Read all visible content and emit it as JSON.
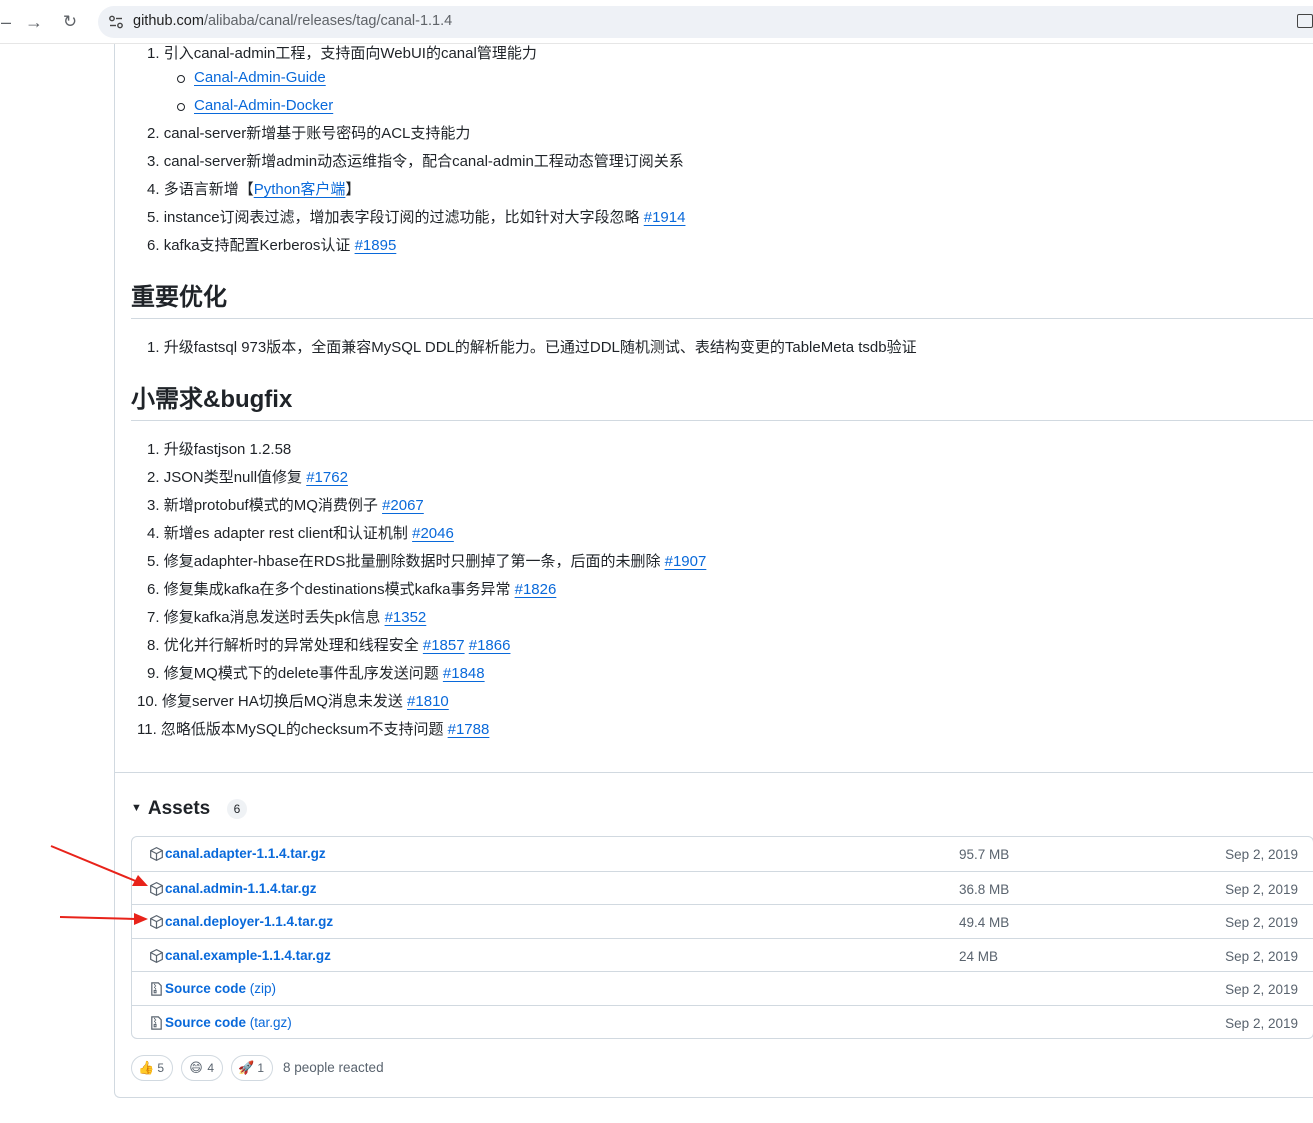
{
  "browser": {
    "url_host": "github.com",
    "url_path": "/alibaba/canal/releases/tag/canal-1.1.4"
  },
  "new_features": {
    "items": [
      {
        "num": "1.",
        "text": "引入canal-admin工程，支持面向WebUI的canal管理能力"
      },
      {
        "num": "2.",
        "text": "canal-server新增基于账号密码的ACL支持能力"
      },
      {
        "num": "3.",
        "text": "canal-server新增admin动态运维指令，配合canal-admin工程动态管理订阅关系"
      },
      {
        "num": "4.",
        "text_before": "多语言新增【",
        "link": "Python客户端",
        "text_after": "】"
      },
      {
        "num": "5.",
        "text": "instance订阅表过滤，增加表字段订阅的过滤功能，比如针对大字段忽略 ",
        "link": "#1914"
      },
      {
        "num": "6.",
        "text": "kafka支持配置Kerberos认证 ",
        "link": "#1895"
      }
    ],
    "sub_items": [
      "Canal-Admin-Guide",
      "Canal-Admin-Docker"
    ]
  },
  "optimization": {
    "heading": "重要优化",
    "items": [
      {
        "num": "1.",
        "text": "升级fastsql 973版本，全面兼容MySQL DDL的解析能力。已通过DDL随机测试、表结构变更的TableMeta tsdb验证"
      }
    ]
  },
  "bugfix": {
    "heading": "小需求&bugfix",
    "items": [
      {
        "num": "1.",
        "text": "升级fastjson 1.2.58",
        "links": []
      },
      {
        "num": "2.",
        "text": "JSON类型null值修复 ",
        "links": [
          "#1762"
        ]
      },
      {
        "num": "3.",
        "text": "新增protobuf模式的MQ消费例子 ",
        "links": [
          "#2067"
        ]
      },
      {
        "num": "4.",
        "text": "新增es adapter rest client和认证机制 ",
        "links": [
          "#2046"
        ]
      },
      {
        "num": "5.",
        "text": "修复adaphter-hbase在RDS批量删除数据时只删掉了第一条，后面的未删除 ",
        "links": [
          "#1907"
        ]
      },
      {
        "num": "6.",
        "text": "修复集成kafka在多个destinations模式kafka事务异常 ",
        "links": [
          "#1826"
        ]
      },
      {
        "num": "7.",
        "text": "修复kafka消息发送时丢失pk信息 ",
        "links": [
          "#1352"
        ]
      },
      {
        "num": "8.",
        "text": "优化并行解析时的异常处理和线程安全 ",
        "links": [
          "#1857",
          "#1866"
        ]
      },
      {
        "num": "9.",
        "text": "修复MQ模式下的delete事件乱序发送问题 ",
        "links": [
          "#1848"
        ]
      },
      {
        "num": "10.",
        "text": "修复server HA切换后MQ消息未发送 ",
        "links": [
          "#1810"
        ]
      },
      {
        "num": "11.",
        "text": "忽略低版本MySQL的checksum不支持问题 ",
        "links": [
          "#1788"
        ]
      }
    ]
  },
  "assets": {
    "label": "Assets",
    "count": "6",
    "rows": [
      {
        "name": "canal.adapter-1.1.4.tar.gz",
        "suffix": "",
        "size": "95.7 MB",
        "date": "Sep 2, 2019",
        "icon": "package-icon"
      },
      {
        "name": "canal.admin-1.1.4.tar.gz",
        "suffix": "",
        "size": "36.8 MB",
        "date": "Sep 2, 2019",
        "icon": "package-icon"
      },
      {
        "name": "canal.deployer-1.1.4.tar.gz",
        "suffix": "",
        "size": "49.4 MB",
        "date": "Sep 2, 2019",
        "icon": "package-icon"
      },
      {
        "name": "canal.example-1.1.4.tar.gz",
        "suffix": "",
        "size": "24 MB",
        "date": "Sep 2, 2019",
        "icon": "package-icon"
      },
      {
        "name": "Source code",
        "suffix": " (zip)",
        "size": "",
        "date": "Sep 2, 2019",
        "icon": "file-zip-icon"
      },
      {
        "name": "Source code",
        "suffix": " (tar.gz)",
        "size": "",
        "date": "Sep 2, 2019",
        "icon": "file-zip-icon"
      }
    ]
  },
  "reactions": {
    "items": [
      {
        "emoji": "👍",
        "count": "5",
        "icon": "thumbs-up-icon"
      },
      {
        "emoji": "😄",
        "count": "4",
        "icon": "laugh-icon"
      },
      {
        "emoji": "🚀",
        "count": "1",
        "icon": "rocket-icon"
      }
    ],
    "summary": "8 people reacted"
  },
  "colors": {
    "link": "#0969da",
    "annotation_arrow": "#e8231a",
    "border": "#d1d9e0"
  }
}
